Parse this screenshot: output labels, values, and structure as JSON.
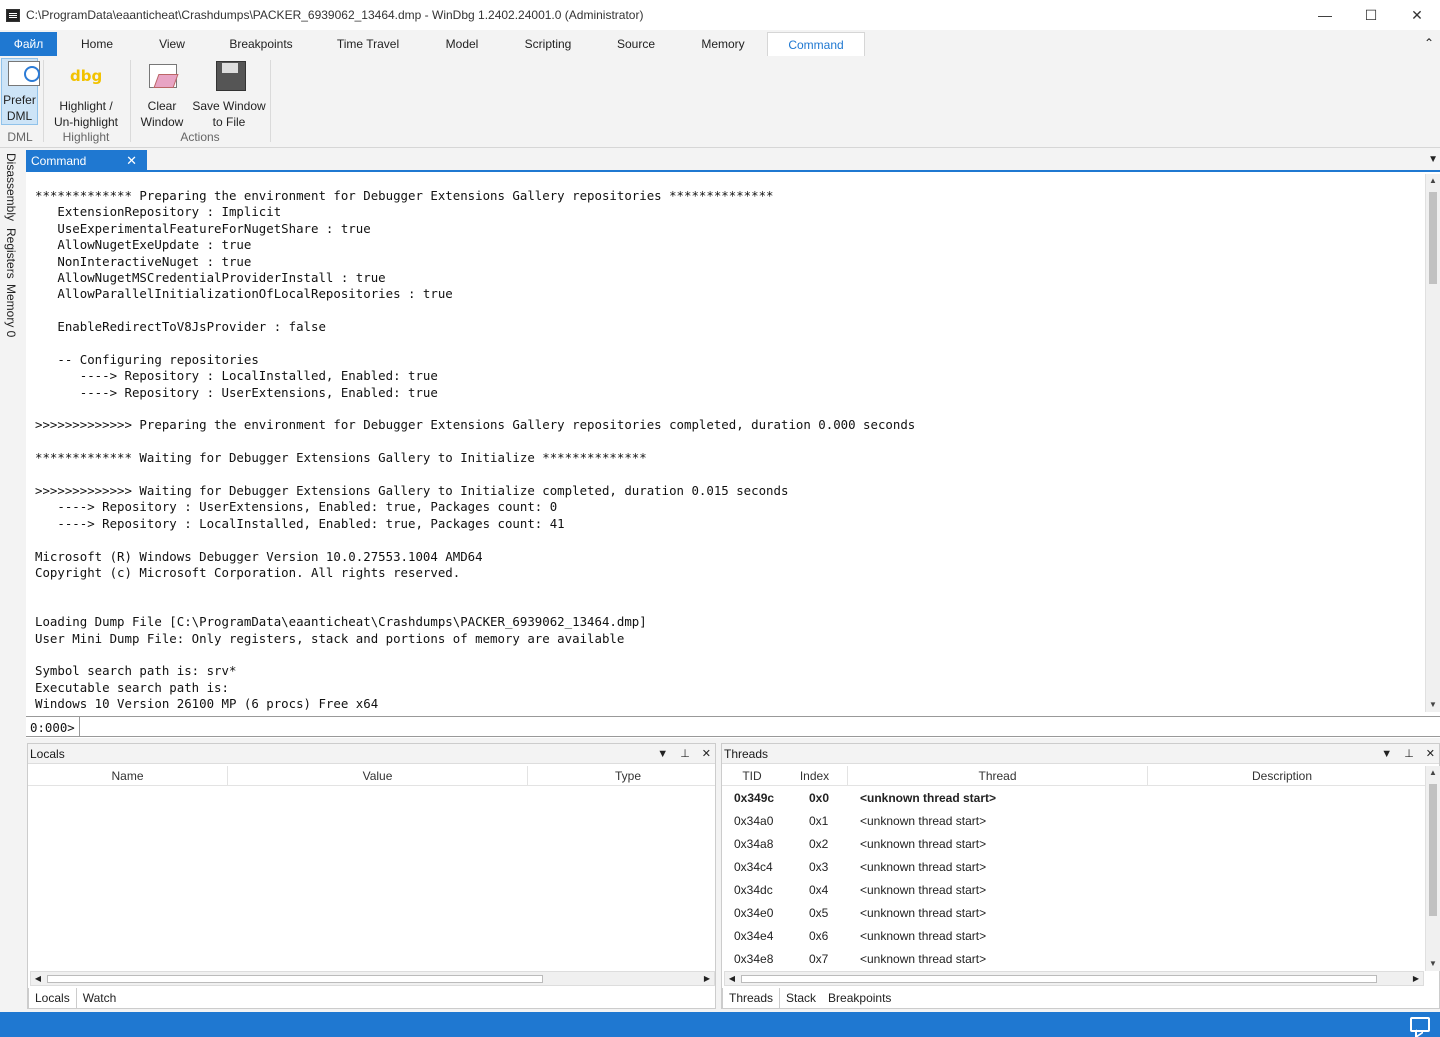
{
  "window": {
    "title": "C:\\ProgramData\\eaanticheat\\Crashdumps\\PACKER_6939062_13464.dmp - WinDbg 1.2402.24001.0 (Administrator)",
    "minimize": "—",
    "maximize": "☐",
    "close": "✕"
  },
  "ribbon": {
    "file_tab": "Файл",
    "tabs": [
      "Home",
      "View",
      "Breakpoints",
      "Time Travel",
      "Model",
      "Scripting",
      "Source",
      "Memory",
      "Command"
    ],
    "active_tab": "Command",
    "collapse_glyph": "⌃",
    "groups": {
      "dml": {
        "label": "DML",
        "button_line1": "Prefer",
        "button_line2": "DML"
      },
      "highlight": {
        "label": "Highlight",
        "icon_text": "dbg",
        "button_line1": "Highlight /",
        "button_line2": "Un-highlight"
      },
      "actions": {
        "label": "Actions",
        "clear_line1": "Clear",
        "clear_line2": "Window",
        "save_line1": "Save Window",
        "save_line2": "to File"
      }
    }
  },
  "side_tabs": [
    "Disassembly",
    "Registers",
    "Memory 0"
  ],
  "command_window": {
    "tab_label": "Command",
    "close_glyph": "✕",
    "menu_glyph": "▼",
    "prompt": "0:000>",
    "input_value": "",
    "output_lines": [
      "************* Preparing the environment for Debugger Extensions Gallery repositories **************",
      "   ExtensionRepository : Implicit",
      "   UseExperimentalFeatureForNugetShare : true",
      "   AllowNugetExeUpdate : true",
      "   NonInteractiveNuget : true",
      "   AllowNugetMSCredentialProviderInstall : true",
      "   AllowParallelInitializationOfLocalRepositories : true",
      "",
      "   EnableRedirectToV8JsProvider : false",
      "",
      "   -- Configuring repositories",
      "      ----> Repository : LocalInstalled, Enabled: true",
      "      ----> Repository : UserExtensions, Enabled: true",
      "",
      ">>>>>>>>>>>>> Preparing the environment for Debugger Extensions Gallery repositories completed, duration 0.000 seconds",
      "",
      "************* Waiting for Debugger Extensions Gallery to Initialize **************",
      "",
      ">>>>>>>>>>>>> Waiting for Debugger Extensions Gallery to Initialize completed, duration 0.015 seconds",
      "   ----> Repository : UserExtensions, Enabled: true, Packages count: 0",
      "   ----> Repository : LocalInstalled, Enabled: true, Packages count: 41",
      "",
      "Microsoft (R) Windows Debugger Version 10.0.27553.1004 AMD64",
      "Copyright (c) Microsoft Corporation. All rights reserved.",
      "",
      "",
      "Loading Dump File [C:\\ProgramData\\eaanticheat\\Crashdumps\\PACKER_6939062_13464.dmp]",
      "User Mini Dump File: Only registers, stack and portions of memory are available",
      "",
      "Symbol search path is: srv*",
      "Executable search path is: ",
      "Windows 10 Version 26100 MP (6 procs) Free x64"
    ]
  },
  "locals_pane": {
    "title": "Locals",
    "columns": [
      "Name",
      "Value",
      "Type"
    ],
    "rows": []
  },
  "threads_pane": {
    "title": "Threads",
    "columns": [
      "TID",
      "Index",
      "Thread",
      "Description"
    ],
    "rows": [
      {
        "tid": "0x349c",
        "index": "0x0",
        "thread": "<unknown thread start>",
        "current": true
      },
      {
        "tid": "0x34a0",
        "index": "0x1",
        "thread": "<unknown thread start>",
        "current": false
      },
      {
        "tid": "0x34a8",
        "index": "0x2",
        "thread": "<unknown thread start>",
        "current": false
      },
      {
        "tid": "0x34c4",
        "index": "0x3",
        "thread": "<unknown thread start>",
        "current": false
      },
      {
        "tid": "0x34dc",
        "index": "0x4",
        "thread": "<unknown thread start>",
        "current": false
      },
      {
        "tid": "0x34e0",
        "index": "0x5",
        "thread": "<unknown thread start>",
        "current": false
      },
      {
        "tid": "0x34e4",
        "index": "0x6",
        "thread": "<unknown thread start>",
        "current": false
      },
      {
        "tid": "0x34e8",
        "index": "0x7",
        "thread": "<unknown thread start>",
        "current": false
      }
    ]
  },
  "pane_icons": {
    "dropdown": "▼",
    "pin": "⊥",
    "close": "✕"
  },
  "left_bottom_tabs": [
    "Locals",
    "Watch"
  ],
  "right_bottom_tabs": [
    "Threads",
    "Stack",
    "Breakpoints"
  ],
  "colors": {
    "accent": "#1f78d1",
    "statusbar": "#1f78d1"
  }
}
